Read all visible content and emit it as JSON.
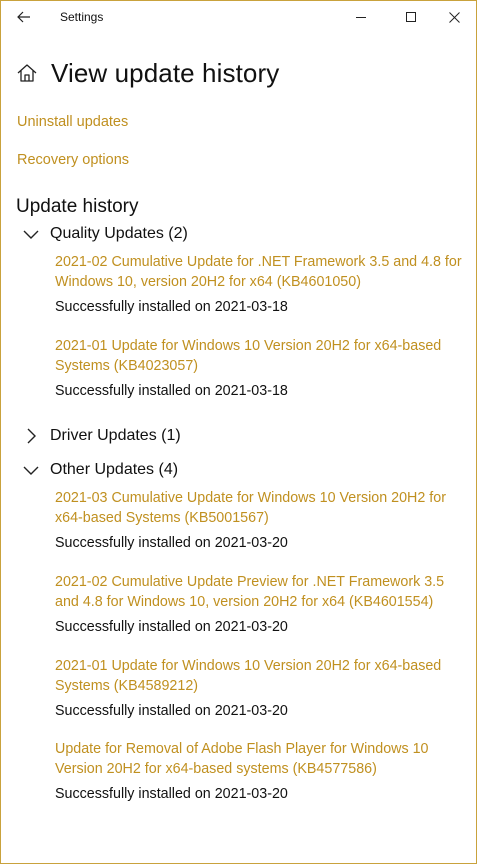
{
  "window": {
    "title": "Settings"
  },
  "page": {
    "title": "View update history"
  },
  "links": {
    "uninstall": "Uninstall updates",
    "recovery": "Recovery options"
  },
  "history": {
    "title": "Update history",
    "groups": [
      {
        "label": "Quality Updates (2)",
        "expanded": true,
        "items": [
          {
            "title": "2021-02 Cumulative Update for .NET Framework 3.5 and 4.8 for Windows 10, version 20H2 for x64 (KB4601050)",
            "status": "Successfully installed on 2021-03-18"
          },
          {
            "title": "2021-01 Update for Windows 10 Version 20H2 for x64-based Systems (KB4023057)",
            "status": "Successfully installed on 2021-03-18"
          }
        ]
      },
      {
        "label": "Driver Updates (1)",
        "expanded": false,
        "items": []
      },
      {
        "label": "Other Updates (4)",
        "expanded": true,
        "items": [
          {
            "title": "2021-03 Cumulative Update for Windows 10 Version 20H2 for x64-based Systems (KB5001567)",
            "status": "Successfully installed on 2021-03-20"
          },
          {
            "title": "2021-02 Cumulative Update Preview for .NET Framework 3.5 and 4.8 for Windows 10, version 20H2 for x64 (KB4601554)",
            "status": "Successfully installed on 2021-03-20"
          },
          {
            "title": "2021-01 Update for Windows 10 Version 20H2 for x64-based Systems (KB4589212)",
            "status": "Successfully installed on 2021-03-20"
          },
          {
            "title": "Update for Removal of Adobe Flash Player for Windows 10 Version 20H2 for x64-based systems (KB4577586)",
            "status": "Successfully installed on 2021-03-20"
          }
        ]
      }
    ]
  },
  "colors": {
    "accent": "#c09020",
    "border": "#c9a23c",
    "text": "#111111"
  },
  "icons": {
    "back": "back-arrow-icon",
    "minimize": "minimize-icon",
    "maximize": "maximize-icon",
    "close": "close-icon",
    "home": "home-icon",
    "expanded": "chevron-down-icon",
    "collapsed": "chevron-right-icon"
  }
}
